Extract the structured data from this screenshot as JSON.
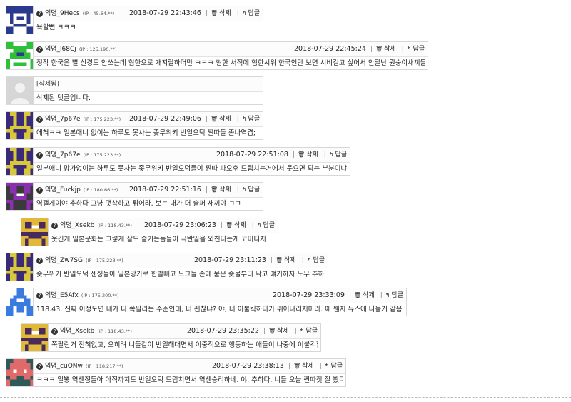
{
  "labels": {
    "delete": "삭제",
    "reply": "답글",
    "delete_icon": "trash-icon",
    "reply_icon": "reply-icon"
  },
  "comments": [
    {
      "user": "익명_9Hecs",
      "ip": "(IP : 45.64.**)",
      "date": "2018-07-29 22:43:46",
      "text": "욕할뻔 ㅋㅋㅋ",
      "avatar_color": "#2b3a8c"
    },
    {
      "user": "익명_l68Cj",
      "ip": "(IP : 125.190.**)",
      "date": "2018-07-29 22:45:24",
      "text": "정작 한국은 별 신경도 안쓰는데 혐한으로 개지랄하더만 ㅋㅋㅋ 혐한 서적에 혐한시위 한국인만 보면 시비걸고 싶어서 안달난 원숭이새끼들까지",
      "avatar_color": "#2fbf3a"
    },
    {
      "deleted_tag": "[삭제됨]",
      "text": "삭제된 댓글입니다.",
      "avatar_color": "#cfcfcf"
    },
    {
      "user": "익명_7p67e",
      "ip": "(IP : 175.223.**)",
      "date": "2018-07-29 22:49:06",
      "text": "에혀ㅋㅋ 일본애니 없이는 하루도 못사는 좆무위키 반일오덕 찐따들 존나역겹;",
      "avatar_color": "#d9c93a"
    },
    {
      "user": "익명_7p67e",
      "ip": "(IP : 175.223.**)",
      "date": "2018-07-29 22:51:08",
      "text": "일본애니 망가없이는 하루도 못사는 좆무위키 반일오덕들이 찐따 파오후 드립치는거에서 웃으면 되는 부분이냐ww",
      "avatar_color": "#d9c93a"
    },
    {
      "user": "익명_Fuckjp",
      "ip": "(IP : 180.66.**)",
      "date": "2018-07-29 22:51:16",
      "text": "역갤게이야 추하다 그냥 댓삭하고 튀어라. 보는 내가 더 슬퍼 새끼야 ㅋㅋ",
      "avatar_color": "#8a2fb0"
    },
    {
      "user": "익명_Xsekb",
      "ip": "(IP : 118.43.**)",
      "date": "2018-07-29 23:06:23",
      "text": "웃긴게 일본문화는 그렇게 잘도 즐기는놈들이 극반일을 외친다는게 코미디지",
      "avatar_color": "#e0b83a"
    },
    {
      "user": "익명_Zw7SG",
      "ip": "(IP : 175.223.**)",
      "date": "2018-07-29 23:11:23",
      "text": "좆무위키 반일오덕 센징들아 일본망가로 한발빼고 느그들 손에 묻은 좆물부터 닦고 얘기하자 노무 추하잖어",
      "avatar_color": "#d9c93a"
    },
    {
      "user": "익명_E5Afx",
      "ip": "(IP : 175.200.**)",
      "date": "2018-07-29 23:33:09",
      "text": "118.43. 진짜 이정도면 내가 다 쪽팔리는 수준인데, 너 괜찮냐? 야, 너 이불킥하다가 뛰어내리지마라. 애 웬지 뉴스에 나올거 같음 ㅋㅋㅋ",
      "avatar_color": "#3a7be0"
    },
    {
      "user": "익명_Xsekb",
      "ip": "(IP : 118.43.**)",
      "date": "2018-07-29 23:35:22",
      "text": "쪽팔린거 전혀없고, 오히려 니들같이 반일해대면서 이중적으로 행동하는 애들이 나중에 이불킥할듯",
      "avatar_color": "#e0b83a"
    },
    {
      "user": "익명_cuQNw",
      "ip": "(IP : 118.217.**)",
      "date": "2018-07-29 23:38:13",
      "text": "ㅋㅋㅋ 일뽕 역센징들아 아직까지도 반일오덕 드립치면서 역센승리하네. 야, 추하다. 니들 오늘 찐따짓 잘 봤다 ㅋㅋ",
      "avatar_color": "#e06a6a"
    }
  ]
}
